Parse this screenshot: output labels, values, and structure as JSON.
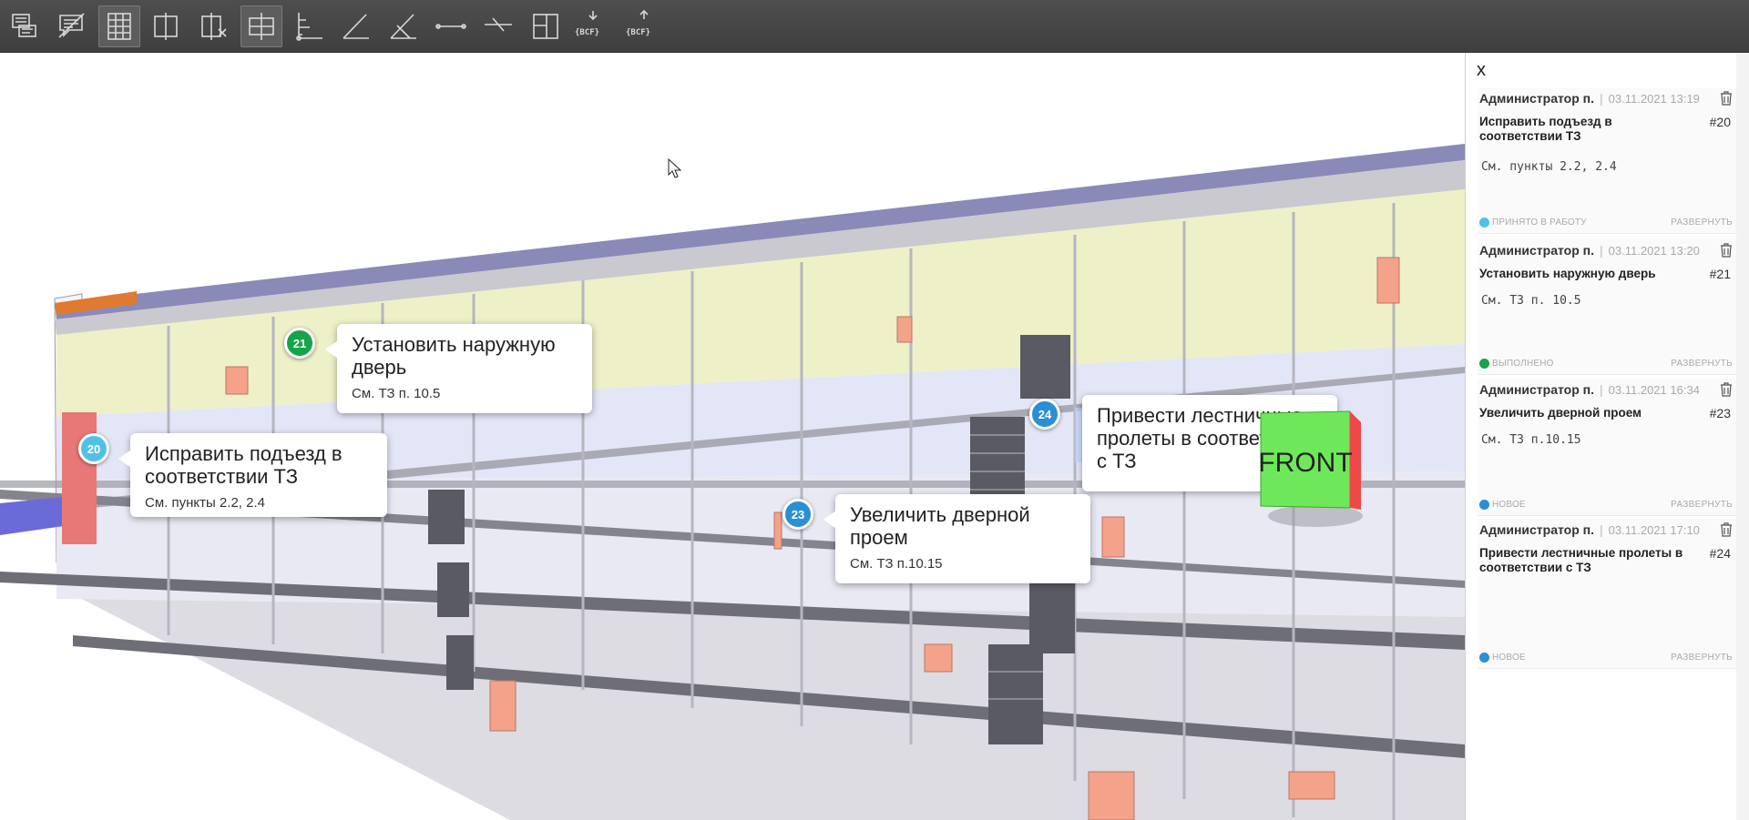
{
  "toolbar": {
    "tools": [
      {
        "name": "comment-list-icon"
      },
      {
        "name": "comment-hide-icon"
      },
      {
        "name": "model-view-icon",
        "active": true
      },
      {
        "name": "section-plane-icon"
      },
      {
        "name": "section-remove-icon"
      },
      {
        "name": "section-box-icon",
        "active": true
      },
      {
        "name": "axes-measure-icon"
      },
      {
        "name": "angle-measure-icon"
      },
      {
        "name": "angle-cross-icon"
      },
      {
        "name": "distance-measure-icon"
      },
      {
        "name": "point-line-icon"
      },
      {
        "name": "floor-plan-icon"
      },
      {
        "name": "bcf-import-icon",
        "label": "{BCF}"
      },
      {
        "name": "bcf-export-icon",
        "label": "{BCF}"
      }
    ]
  },
  "viewport": {
    "navcube_label": "FRONT",
    "markers": [
      {
        "id": "20",
        "title": "Исправить подъезд в соответствии ТЗ",
        "desc": "См. пункты 2.2, 2.4",
        "color": "#4fc1e9"
      },
      {
        "id": "21",
        "title": "Установить наружную дверь",
        "desc": "См. ТЗ п. 10.5",
        "color": "#16a34a"
      },
      {
        "id": "23",
        "title": "Увеличить дверной проем",
        "desc": "См. ТЗ п.10.15",
        "color": "#2a8fd4"
      },
      {
        "id": "24",
        "title": "Привести лестничные пролеты в соответствии с ТЗ",
        "desc": "",
        "color": "#2a8fd4"
      }
    ]
  },
  "panel": {
    "close_label": "x",
    "cards": [
      {
        "author": "Администратор п.",
        "date": "03.11.2021 13:19",
        "title": "Исправить подъезд в соответствии ТЗ",
        "number": "#20",
        "body": "См. пункты 2.2, 2.4",
        "status": "ПРИНЯТО В РАБОТУ",
        "status_color": "#4fc1e9",
        "expand": "РАЗВЕРНУТЬ"
      },
      {
        "author": "Администратор п.",
        "date": "03.11.2021 13:20",
        "title": "Установить наружную дверь",
        "number": "#21",
        "body": "См. ТЗ п. 10.5",
        "status": "ВЫПОЛНЕНО",
        "status_color": "#16a34a",
        "expand": "РАЗВЕРНУТЬ"
      },
      {
        "author": "Администратор п.",
        "date": "03.11.2021 16:34",
        "title": "Увеличить дверной проем",
        "number": "#23",
        "body": "См. ТЗ п.10.15",
        "status": "НОВОЕ",
        "status_color": "#2a8fd4",
        "expand": "РАЗВЕРНУТЬ"
      },
      {
        "author": "Администратор п.",
        "date": "03.11.2021 17:10",
        "title": "Привести лестничные пролеты в соответствии с ТЗ",
        "number": "#24",
        "body": "",
        "status": "НОВОЕ",
        "status_color": "#2a8fd4",
        "expand": "РАЗВЕРНУТЬ"
      }
    ]
  }
}
